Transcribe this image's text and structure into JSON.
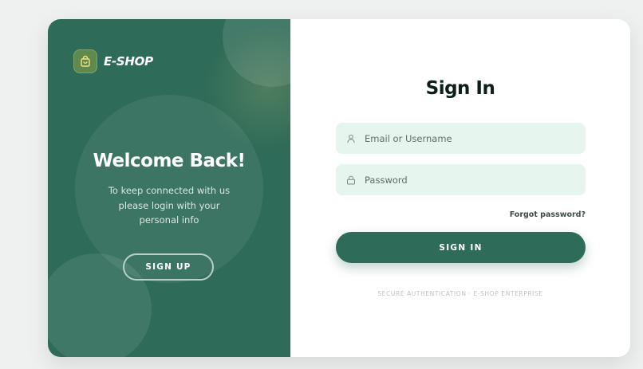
{
  "brand": {
    "name": "E-SHOP",
    "icon": "shopping-bag-icon"
  },
  "left_panel": {
    "heading": "Welcome Back!",
    "subtext": "To keep connected with us please login with your personal info",
    "signup_label": "SIGN UP"
  },
  "form": {
    "title": "Sign In",
    "email_placeholder": "Email or Username",
    "email_icon": "user-icon",
    "password_placeholder": "Password",
    "password_icon": "lock-icon",
    "forgot_label": "Forgot password?",
    "signin_label": "SIGN IN",
    "footer_note": "SECURE AUTHENTICATION · E-SHOP ENTERPRISE"
  },
  "colors": {
    "primary": "#2e6b58",
    "input_bg": "#e6f6ef",
    "title": "#0c1f18",
    "brand_icon_bg": "#5e8a4d"
  }
}
